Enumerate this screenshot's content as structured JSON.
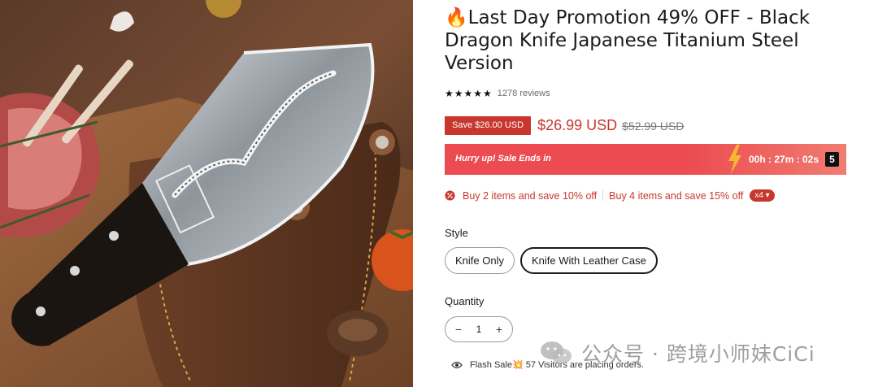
{
  "product": {
    "title": "🔥Last Day Promotion 49% OFF - Black Dragon Knife Japanese Titanium Steel Version",
    "rating": {
      "stars": "★★★★★",
      "reviews": "1278 reviews"
    },
    "price": {
      "save_badge": "Save $26.00 USD",
      "current": "$26.99 USD",
      "original": "$52.99 USD"
    },
    "countdown": {
      "label": "Hurry up! Sale Ends in",
      "time": "00h : 27m : 02s",
      "extra": "5"
    },
    "offer": {
      "part1": "Buy 2 items and save 10% off",
      "part2": "Buy 4 items and save 15% off",
      "multiplier": "x4 ▾"
    },
    "style": {
      "label": "Style",
      "options": [
        "Knife Only",
        "Knife With Leather Case"
      ],
      "selected": "Knife With Leather Case"
    },
    "quantity": {
      "label": "Quantity",
      "value": "1",
      "minus": "−",
      "plus": "+"
    },
    "visitors": {
      "text": "Flash Sale💥 57 Visitors are placing orders."
    }
  },
  "watermark": {
    "text": "公众号 · 跨境小师妹CiCi"
  },
  "icons": [
    "fire-icon",
    "star-icon",
    "lightning-icon",
    "percent-badge-icon",
    "eye-icon",
    "wechat-icon"
  ],
  "colors": {
    "accent": "#c8372d",
    "countdown_bg": "#ec4c51",
    "text": "#1b1b1b"
  }
}
